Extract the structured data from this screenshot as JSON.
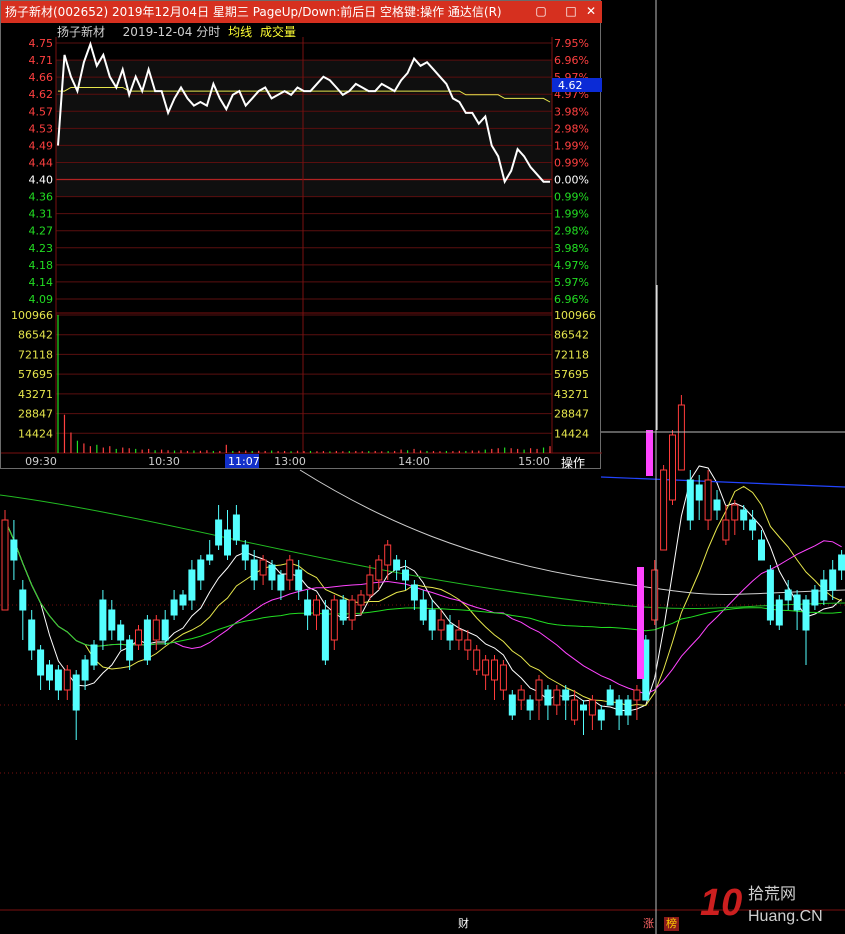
{
  "window": {
    "title": "扬子新材(002652) 2019年12月04日 星期三 PageUp/Down:前后日 空格键:操作 通达信(R)",
    "stock_name": "扬子新材",
    "date": "2019-12-04",
    "chart_mode": "分时",
    "avg_line_label": "均线",
    "volume_label": "成交量",
    "current_price": "4.62",
    "operate_label": "操作",
    "cursor_time": "11:07"
  },
  "intraday_chart": {
    "type": "line",
    "price_ticks": [
      "4.75",
      "4.71",
      "4.66",
      "4.62",
      "4.57",
      "4.53",
      "4.49",
      "4.44",
      "4.40",
      "4.36",
      "4.31",
      "4.27",
      "4.23",
      "4.18",
      "4.14",
      "4.09"
    ],
    "pct_ticks": [
      "7.95%",
      "6.96%",
      "5.97%",
      "4.97%",
      "3.98%",
      "2.98%",
      "1.99%",
      "0.99%",
      "0.00%",
      "0.99%",
      "1.99%",
      "2.98%",
      "3.98%",
      "4.97%",
      "5.97%",
      "6.96%"
    ],
    "volume_ticks": [
      "100966",
      "86542",
      "72118",
      "57695",
      "43271",
      "28847",
      "14424"
    ],
    "time_ticks": [
      "09:30",
      "10:30",
      "13:00",
      "14:00",
      "15:00"
    ],
    "prev_close": 4.4,
    "price_series": [
      4.47,
      4.72,
      4.66,
      4.62,
      4.7,
      4.75,
      4.69,
      4.72,
      4.66,
      4.63,
      4.68,
      4.61,
      4.66,
      4.62,
      4.68,
      4.62,
      4.62,
      4.56,
      4.6,
      4.63,
      4.6,
      4.58,
      4.59,
      4.58,
      4.64,
      4.6,
      4.57,
      4.61,
      4.62,
      4.58,
      4.6,
      4.62,
      4.63,
      4.6,
      4.61,
      4.62,
      4.61,
      4.63,
      4.62,
      4.62,
      4.64,
      4.66,
      4.65,
      4.63,
      4.61,
      4.62,
      4.64,
      4.63,
      4.62,
      4.62,
      4.64,
      4.63,
      4.62,
      4.65,
      4.67,
      4.71,
      4.69,
      4.7,
      4.68,
      4.66,
      4.64,
      4.6,
      4.59,
      4.56,
      4.56,
      4.53,
      4.55,
      4.47,
      4.44,
      4.37,
      4.4,
      4.46,
      4.44,
      4.41,
      4.39,
      4.37,
      4.37
    ],
    "avg_series": [
      4.62,
      4.62,
      4.63,
      4.63,
      4.63,
      4.63,
      4.63,
      4.63,
      4.63,
      4.63,
      4.63,
      4.62,
      4.62,
      4.62,
      4.62,
      4.62,
      4.62,
      4.62,
      4.62,
      4.62,
      4.62,
      4.62,
      4.62,
      4.62,
      4.62,
      4.62,
      4.62,
      4.62,
      4.62,
      4.62,
      4.62,
      4.62,
      4.62,
      4.62,
      4.62,
      4.62,
      4.62,
      4.62,
      4.62,
      4.62,
      4.62,
      4.62,
      4.62,
      4.62,
      4.62,
      4.62,
      4.62,
      4.62,
      4.62,
      4.62,
      4.62,
      4.62,
      4.62,
      4.62,
      4.62,
      4.62,
      4.62,
      4.62,
      4.62,
      4.62,
      4.62,
      4.62,
      4.62,
      4.61,
      4.61,
      4.61,
      4.61,
      4.61,
      4.61,
      4.6,
      4.6,
      4.6,
      4.6,
      4.6,
      4.6,
      4.6,
      4.59
    ],
    "volume_series": [
      100966,
      28000,
      15000,
      9000,
      7000,
      5000,
      6000,
      4000,
      5000,
      3000,
      4000,
      3500,
      3000,
      2500,
      3000,
      2000,
      2500,
      2000,
      1800,
      2000,
      1500,
      1800,
      1600,
      2000,
      1500,
      1500,
      6000,
      1500,
      1500,
      1800,
      1500,
      1600,
      1500,
      1800,
      1400,
      1500,
      1300,
      1600,
      1400,
      1500,
      1300,
      1400,
      1200,
      1500,
      1300,
      1400,
      1500,
      1300,
      1400,
      1500,
      1300,
      1400,
      1500,
      2500,
      2000,
      3000,
      1800,
      1500,
      1400,
      1300,
      1500,
      1400,
      1600,
      1500,
      1800,
      1700,
      2500,
      3000,
      3500,
      4000,
      3500,
      3000,
      2500,
      3500,
      3000,
      4000,
      5000
    ]
  },
  "kline_chart": {
    "type": "candlestick",
    "candles": [
      [
        610,
        520,
        510,
        545
      ],
      [
        540,
        560,
        520,
        580
      ],
      [
        590,
        610,
        580,
        640
      ],
      [
        620,
        650,
        610,
        660
      ],
      [
        650,
        675,
        645,
        690
      ],
      [
        665,
        680,
        660,
        690
      ],
      [
        670,
        690,
        665,
        700
      ],
      [
        690,
        670,
        665,
        700
      ],
      [
        675,
        710,
        670,
        740
      ],
      [
        660,
        680,
        655,
        690
      ],
      [
        645,
        665,
        640,
        670
      ],
      [
        600,
        640,
        590,
        650
      ],
      [
        610,
        630,
        600,
        640
      ],
      [
        625,
        640,
        620,
        650
      ],
      [
        640,
        660,
        635,
        670
      ],
      [
        645,
        630,
        625,
        650
      ],
      [
        620,
        660,
        615,
        665
      ],
      [
        640,
        620,
        615,
        650
      ],
      [
        620,
        640,
        610,
        645
      ],
      [
        600,
        615,
        590,
        620
      ],
      [
        595,
        605,
        590,
        610
      ],
      [
        570,
        600,
        560,
        610
      ],
      [
        560,
        580,
        555,
        590
      ],
      [
        555,
        560,
        540,
        565
      ],
      [
        520,
        545,
        505,
        550
      ],
      [
        530,
        555,
        510,
        560
      ],
      [
        515,
        540,
        505,
        545
      ],
      [
        545,
        560,
        540,
        570
      ],
      [
        560,
        580,
        550,
        590
      ],
      [
        575,
        560,
        555,
        585
      ],
      [
        565,
        580,
        560,
        590
      ],
      [
        575,
        590,
        570,
        600
      ],
      [
        580,
        560,
        555,
        590
      ],
      [
        570,
        590,
        560,
        600
      ],
      [
        600,
        615,
        590,
        630
      ],
      [
        615,
        600,
        595,
        630
      ],
      [
        610,
        660,
        600,
        665
      ],
      [
        640,
        600,
        595,
        650
      ],
      [
        600,
        620,
        595,
        625
      ],
      [
        620,
        600,
        595,
        630
      ],
      [
        605,
        595,
        590,
        615
      ],
      [
        595,
        575,
        565,
        600
      ],
      [
        580,
        560,
        555,
        590
      ],
      [
        565,
        545,
        540,
        580
      ],
      [
        560,
        570,
        555,
        580
      ],
      [
        570,
        580,
        560,
        590
      ],
      [
        585,
        600,
        580,
        610
      ],
      [
        600,
        620,
        590,
        625
      ],
      [
        610,
        630,
        600,
        640
      ],
      [
        630,
        620,
        610,
        640
      ],
      [
        625,
        640,
        615,
        650
      ],
      [
        640,
        630,
        620,
        650
      ],
      [
        650,
        640,
        630,
        660
      ],
      [
        670,
        650,
        645,
        675
      ],
      [
        675,
        660,
        655,
        690
      ],
      [
        680,
        660,
        655,
        700
      ],
      [
        690,
        665,
        660,
        700
      ],
      [
        695,
        715,
        690,
        720
      ],
      [
        700,
        690,
        685,
        710
      ],
      [
        700,
        710,
        695,
        720
      ],
      [
        700,
        680,
        675,
        720
      ],
      [
        690,
        705,
        685,
        720
      ],
      [
        705,
        690,
        685,
        715
      ],
      [
        690,
        700,
        685,
        720
      ],
      [
        720,
        700,
        690,
        725
      ],
      [
        705,
        710,
        700,
        735
      ],
      [
        715,
        700,
        695,
        730
      ],
      [
        710,
        720,
        705,
        730
      ],
      [
        690,
        705,
        685,
        705
      ],
      [
        700,
        715,
        695,
        730
      ],
      [
        700,
        715,
        695,
        725
      ],
      [
        700,
        690,
        685,
        720
      ],
      [
        640,
        700,
        635,
        700
      ],
      [
        620,
        570,
        560,
        625
      ],
      [
        550,
        470,
        465,
        550
      ],
      [
        500,
        435,
        430,
        505
      ],
      [
        470,
        405,
        395,
        470
      ],
      [
        480,
        520,
        470,
        530
      ],
      [
        485,
        500,
        475,
        520
      ],
      [
        520,
        480,
        470,
        530
      ],
      [
        500,
        510,
        490,
        520
      ],
      [
        540,
        520,
        505,
        545
      ],
      [
        520,
        505,
        500,
        535
      ],
      [
        510,
        520,
        505,
        530
      ],
      [
        520,
        530,
        510,
        540
      ],
      [
        540,
        560,
        530,
        560
      ],
      [
        570,
        620,
        565,
        625
      ],
      [
        600,
        625,
        595,
        630
      ],
      [
        590,
        600,
        580,
        610
      ],
      [
        595,
        610,
        590,
        630
      ],
      [
        600,
        630,
        595,
        665
      ],
      [
        590,
        605,
        585,
        610
      ],
      [
        580,
        600,
        570,
        605
      ],
      [
        570,
        590,
        560,
        600
      ],
      [
        555,
        570,
        550,
        580
      ]
    ]
  }
}
